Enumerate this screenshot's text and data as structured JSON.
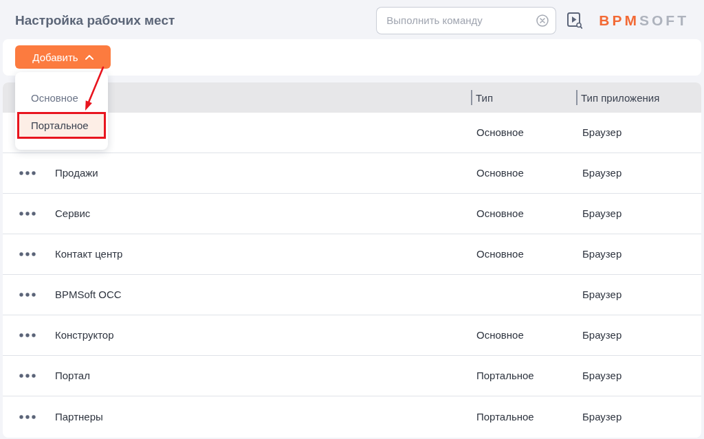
{
  "header": {
    "title": "Настройка рабочих мест",
    "command_search": {
      "placeholder": "Выполнить команду"
    },
    "logo": {
      "lead": "BPM",
      "tail": "SOFT"
    }
  },
  "toolbar": {
    "add_button": {
      "label": "Добавить",
      "expanded": true
    }
  },
  "add_menu": {
    "items": [
      {
        "label": "Основное",
        "selected": false,
        "callout": false
      },
      {
        "label": "Портальное",
        "selected": true,
        "callout": true
      }
    ],
    "callout_arrow": true
  },
  "table": {
    "columns": [
      {
        "label": "Тип"
      },
      {
        "label": "Тип приложения"
      }
    ],
    "rows": [
      {
        "type": "Основное",
        "app_type": "Браузер"
      },
      {
        "name": "Продажи",
        "type": "Основное",
        "app_type": "Браузер"
      },
      {
        "name": "Сервис",
        "type": "Основное",
        "app_type": "Браузер"
      },
      {
        "name": "Контакт центр",
        "type": "Основное",
        "app_type": "Браузер"
      },
      {
        "name": "BPMSoft OCC",
        "app_type": "Браузер"
      },
      {
        "name": "Конструктор",
        "type": "Основное",
        "app_type": "Браузер"
      },
      {
        "name": "Портал",
        "type": "Портальное",
        "app_type": "Браузер"
      },
      {
        "name": "Партнеры",
        "type": "Портальное",
        "app_type": "Браузер"
      }
    ]
  }
}
